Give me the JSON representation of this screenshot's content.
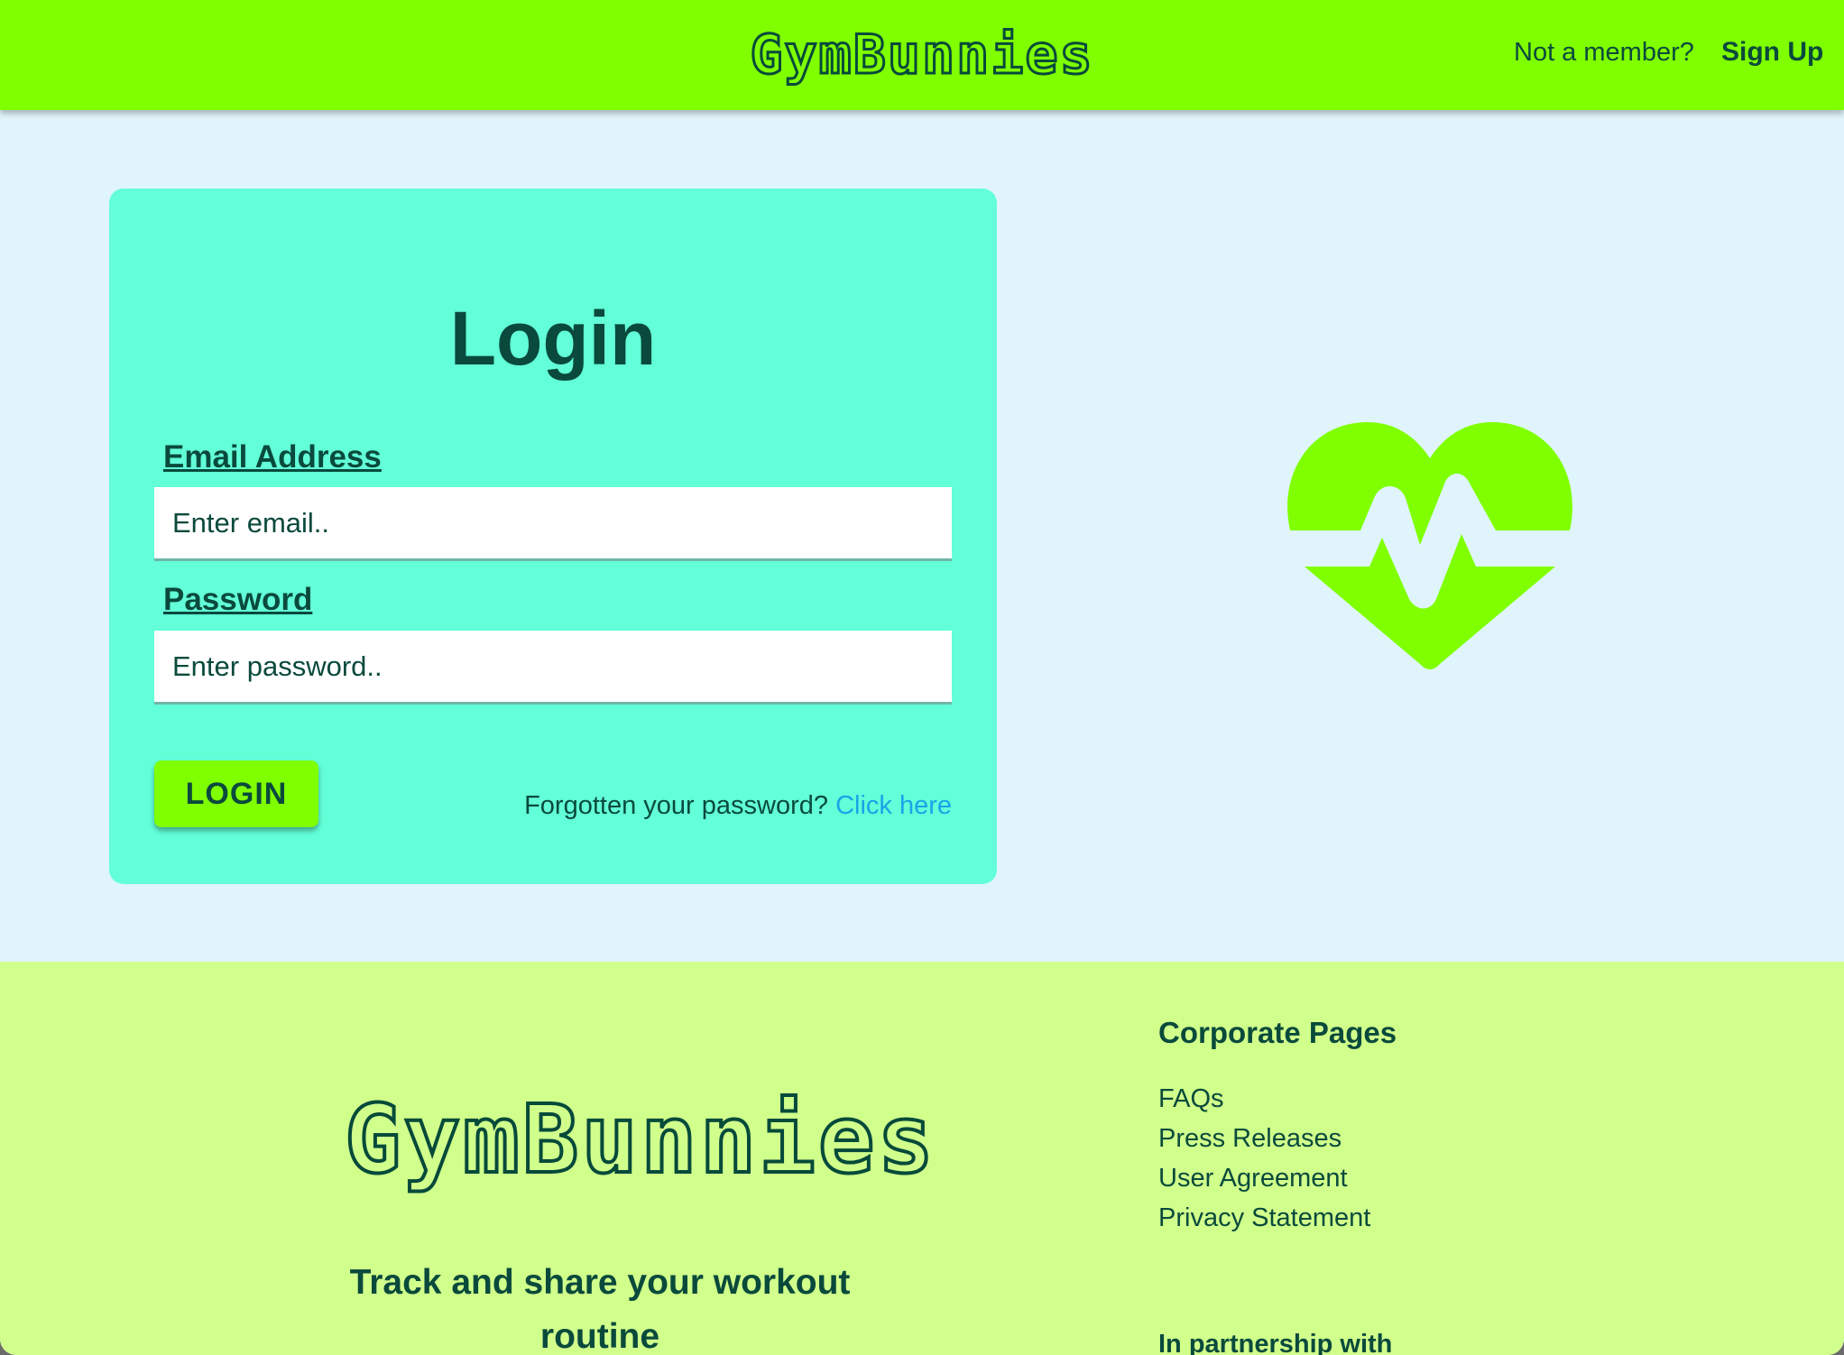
{
  "header": {
    "brand": "GymBunnies",
    "not_member_text": "Not a member?",
    "signup_label": "Sign Up"
  },
  "login": {
    "title": "Login",
    "email_label": "Email Address",
    "email_placeholder": "Enter email..",
    "email_value": "",
    "password_label": "Password",
    "password_placeholder": "Enter password..",
    "password_value": "",
    "button_label": "LOGIN",
    "forgot_text": "Forgotten your password?",
    "forgot_link": "Click here"
  },
  "hero": {
    "icon": "heart-pulse-icon"
  },
  "footer": {
    "brand": "GymBunnies",
    "tagline": "Track and share your workout routine",
    "corporate_title": "Corporate Pages",
    "corporate_links": [
      "FAQs",
      "Press Releases",
      "User Agreement",
      "Privacy Statement"
    ],
    "partnership_title": "In partnership with"
  },
  "colors": {
    "header_bg": "#7fff00",
    "page_bg": "#e0f4fb",
    "card_bg": "#62ffd8",
    "footer_bg": "#d1ff8c",
    "text_dark": "#0a4a3c",
    "link_blue": "#1aa3e8",
    "accent_green": "#7fff00"
  }
}
